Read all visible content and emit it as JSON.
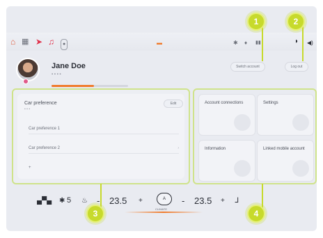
{
  "status_bar": {
    "icons": [
      "home-icon",
      "grid-icon",
      "navigation-icon",
      "music-icon",
      "dab-icon",
      "notification-icon",
      "bluetooth-icon",
      "mic-icon",
      "signal-icon",
      "moon-icon",
      "volume-icon"
    ]
  },
  "header_buttons": {
    "switch_account": "Switch account",
    "log_out": "Log out"
  },
  "profile": {
    "name": "Jane Doe",
    "progress": 0.55
  },
  "car_preference": {
    "title": "Car preference",
    "edit_label": "Edit",
    "rows": [
      {
        "label": "Car preference 1",
        "value": ""
      },
      {
        "label": "Car preference 2",
        "value": ""
      }
    ]
  },
  "tiles": [
    {
      "label": "Account connections"
    },
    {
      "label": "Settings"
    },
    {
      "label": "Information"
    },
    {
      "label": "Linked mobile account"
    }
  ],
  "climate": {
    "fan_speed": "5",
    "left_temp": "23.5",
    "right_temp": "23.5",
    "center_label": "CLIMATE",
    "center_icon_text": "A",
    "minus": "-",
    "plus": "+"
  },
  "callouts": [
    "1",
    "2",
    "3",
    "4"
  ],
  "colors": {
    "accent": "#f07a2a",
    "callout": "#c7da2c",
    "highlight_border": "#cfe38a"
  }
}
